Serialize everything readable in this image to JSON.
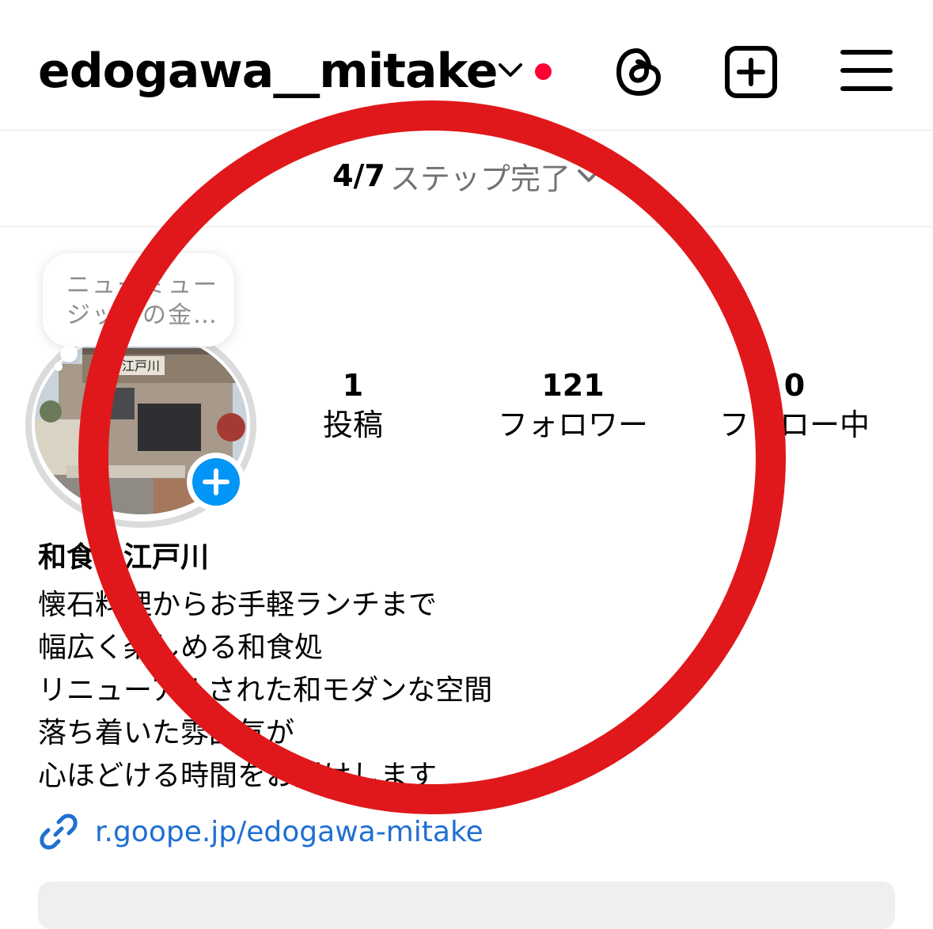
{
  "header": {
    "username": "edogawa__mitake"
  },
  "steps": {
    "count": "4/7",
    "label": "ステップ完了"
  },
  "note": {
    "lines": [
      "ニューミュー",
      "ジックの金…"
    ]
  },
  "stats": [
    {
      "value": "1",
      "label": "投稿"
    },
    {
      "value": "121",
      "label": "フォロワー"
    },
    {
      "value": "0",
      "label": "フォロー中"
    }
  ],
  "profile": {
    "display_name": "和食　江戸川",
    "bio_lines": [
      "懐石料理からお手軽ランチまで",
      "幅広く楽しめる和食処",
      "リニューアルされた和モダンな空間",
      "落ち着いた雰囲気が",
      "心ほどける時間をお届けします"
    ],
    "link": "r.goope.jp/edogawa-mitake",
    "avatar_sign": "江戸川"
  },
  "colors": {
    "notification_dot": "#ff0033",
    "accent_blue": "#0095f6",
    "link_blue": "#1f6fd1",
    "annotation_red": "#e0181b"
  }
}
